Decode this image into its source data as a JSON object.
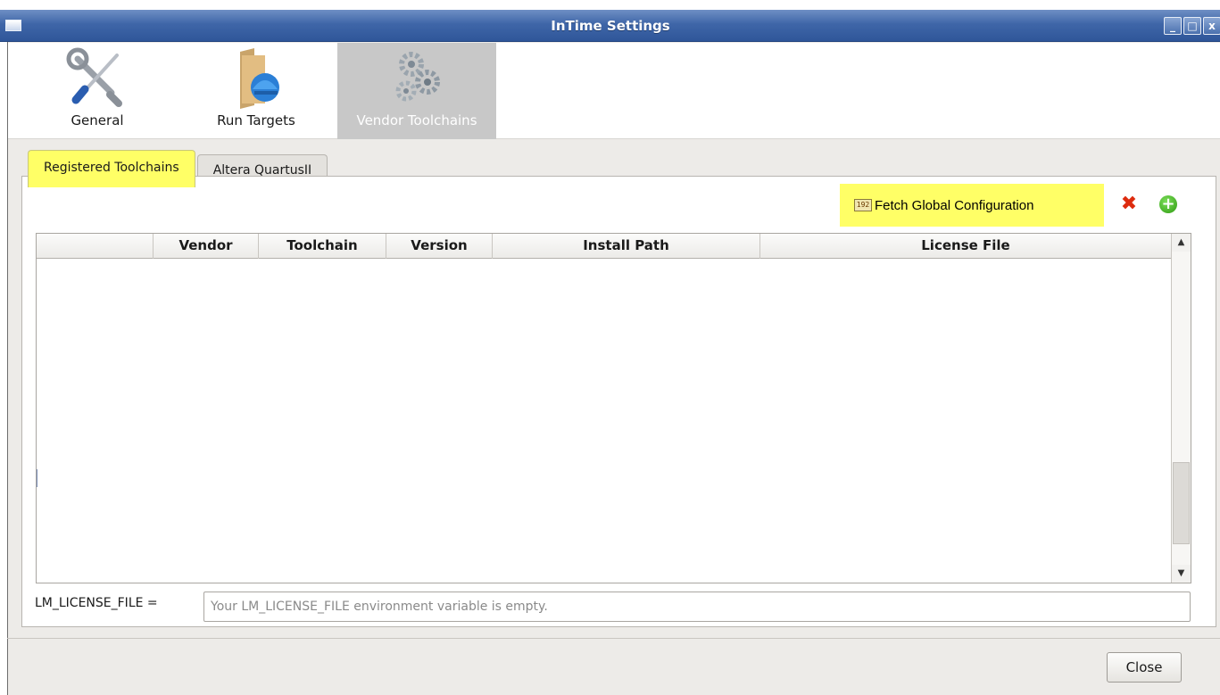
{
  "window": {
    "title": "InTime Settings",
    "controls": {
      "minimize": "_",
      "maximize": "□",
      "close": "x"
    }
  },
  "pages": [
    {
      "label": "General",
      "icon": "wrench-screwdriver-icon",
      "active": false
    },
    {
      "label": "Run Targets",
      "icon": "folder-globe-icon",
      "active": false
    },
    {
      "label": "Vendor Toolchains",
      "icon": "gears-icon",
      "active": true
    }
  ],
  "tabs": [
    {
      "label": "Registered Toolchains",
      "active": true
    },
    {
      "label": "Altera QuartusII",
      "active": false
    }
  ],
  "actions": {
    "fetch_label": "Fetch Global Configuration",
    "fetch_icon_text": "192",
    "delete_icon": "delete-icon",
    "add_icon": "add-icon"
  },
  "table": {
    "columns": [
      "",
      "Vendor",
      "Toolchain",
      "Version",
      "Install Path",
      "License File"
    ],
    "rows": []
  },
  "license": {
    "label": "LM_LICENSE_FILE =",
    "placeholder": "Your LM_LICENSE_FILE environment variable is empty.",
    "value": ""
  },
  "footer": {
    "close_label": "Close"
  },
  "colors": {
    "highlight": "#ffff66",
    "titlebar": "#3f66a8",
    "delete": "#dd2b0e",
    "add": "#2e9a12"
  }
}
